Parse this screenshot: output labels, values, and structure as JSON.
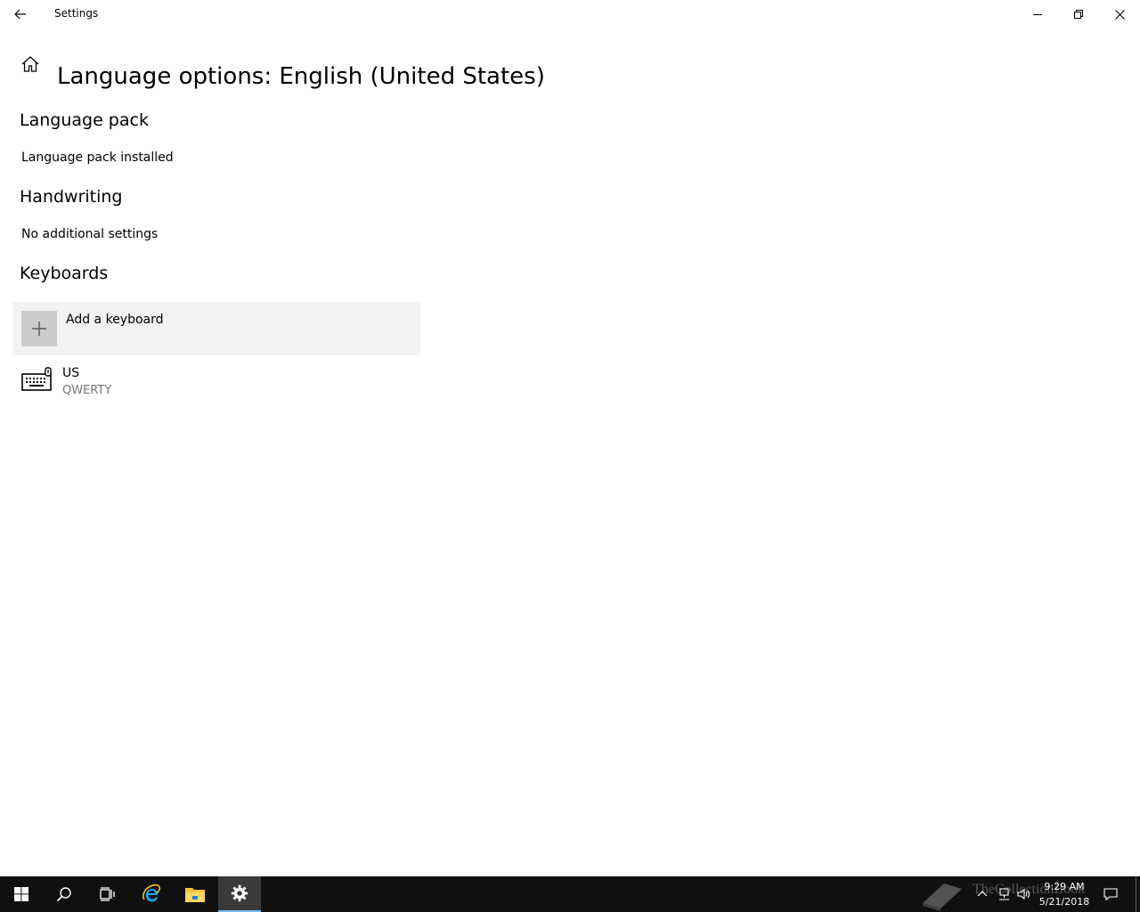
{
  "window": {
    "title": "Settings"
  },
  "header": {
    "page_title": "Language options: English (United States)"
  },
  "sections": {
    "language_pack": {
      "heading": "Language pack",
      "status": "Language pack installed"
    },
    "handwriting": {
      "heading": "Handwriting",
      "status": "No additional settings"
    },
    "keyboards": {
      "heading": "Keyboards",
      "add_label": "Add a keyboard",
      "items": [
        {
          "name": "US",
          "layout": "QWERTY"
        }
      ]
    }
  },
  "taskbar": {
    "pinned": [
      "start-icon",
      "search-icon",
      "task-view-icon",
      "internet-explorer-icon",
      "file-explorer-icon",
      "settings-icon"
    ],
    "active": "settings-icon",
    "clock": {
      "time": "9:29 AM",
      "date": "5/21/2018"
    },
    "watermark": "TheCollectionBook"
  },
  "colors": {
    "accent": "#76b9ed",
    "taskbar": "#101010",
    "add_row_bg": "#f2f2f2",
    "secondary_text": "#767676"
  }
}
